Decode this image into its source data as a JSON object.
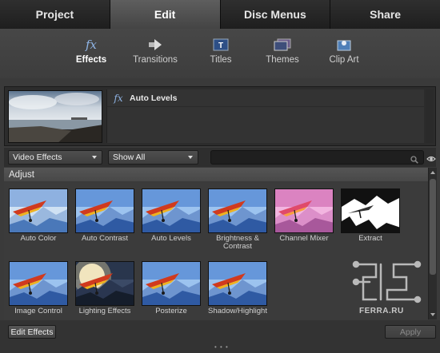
{
  "tabs": [
    {
      "label": "Project",
      "active": false
    },
    {
      "label": "Edit",
      "active": true
    },
    {
      "label": "Disc Menus",
      "active": false
    },
    {
      "label": "Share",
      "active": false
    }
  ],
  "subnav": [
    {
      "label": "Effects",
      "icon": "fx-icon",
      "active": true
    },
    {
      "label": "Transitions",
      "icon": "transitions-icon",
      "active": false
    },
    {
      "label": "Titles",
      "icon": "titles-icon",
      "active": false
    },
    {
      "label": "Themes",
      "icon": "themes-icon",
      "active": false
    },
    {
      "label": "Clip Art",
      "icon": "clip-art-icon",
      "active": false
    }
  ],
  "preview": {
    "fx_glyph": "fx",
    "effect_name": "Auto Levels"
  },
  "filters": {
    "category": "Video Effects",
    "show": "Show All",
    "search_value": ""
  },
  "category_header": "Adjust",
  "effects": [
    {
      "label": "Auto Color",
      "variant": "autocolor"
    },
    {
      "label": "Auto Contrast",
      "variant": "normal"
    },
    {
      "label": "Auto Levels",
      "variant": "normal"
    },
    {
      "label": "Brightness & Contrast",
      "variant": "normal"
    },
    {
      "label": "Channel Mixer",
      "variant": "pink"
    },
    {
      "label": "Extract",
      "variant": "extract"
    },
    {
      "label": "Image Control",
      "variant": "normal"
    },
    {
      "label": "Lighting Effects",
      "variant": "lighting"
    },
    {
      "label": "Posterize",
      "variant": "normal"
    },
    {
      "label": "Shadow/Highlight",
      "variant": "normal"
    }
  ],
  "buttons": {
    "edit_effects": "Edit Effects",
    "apply": "Apply"
  },
  "watermark": {
    "text": "FERRA.RU"
  },
  "colors": {
    "accent": "#8fb4e6",
    "tab_active": "#555555",
    "panel": "#3b3b3b"
  }
}
